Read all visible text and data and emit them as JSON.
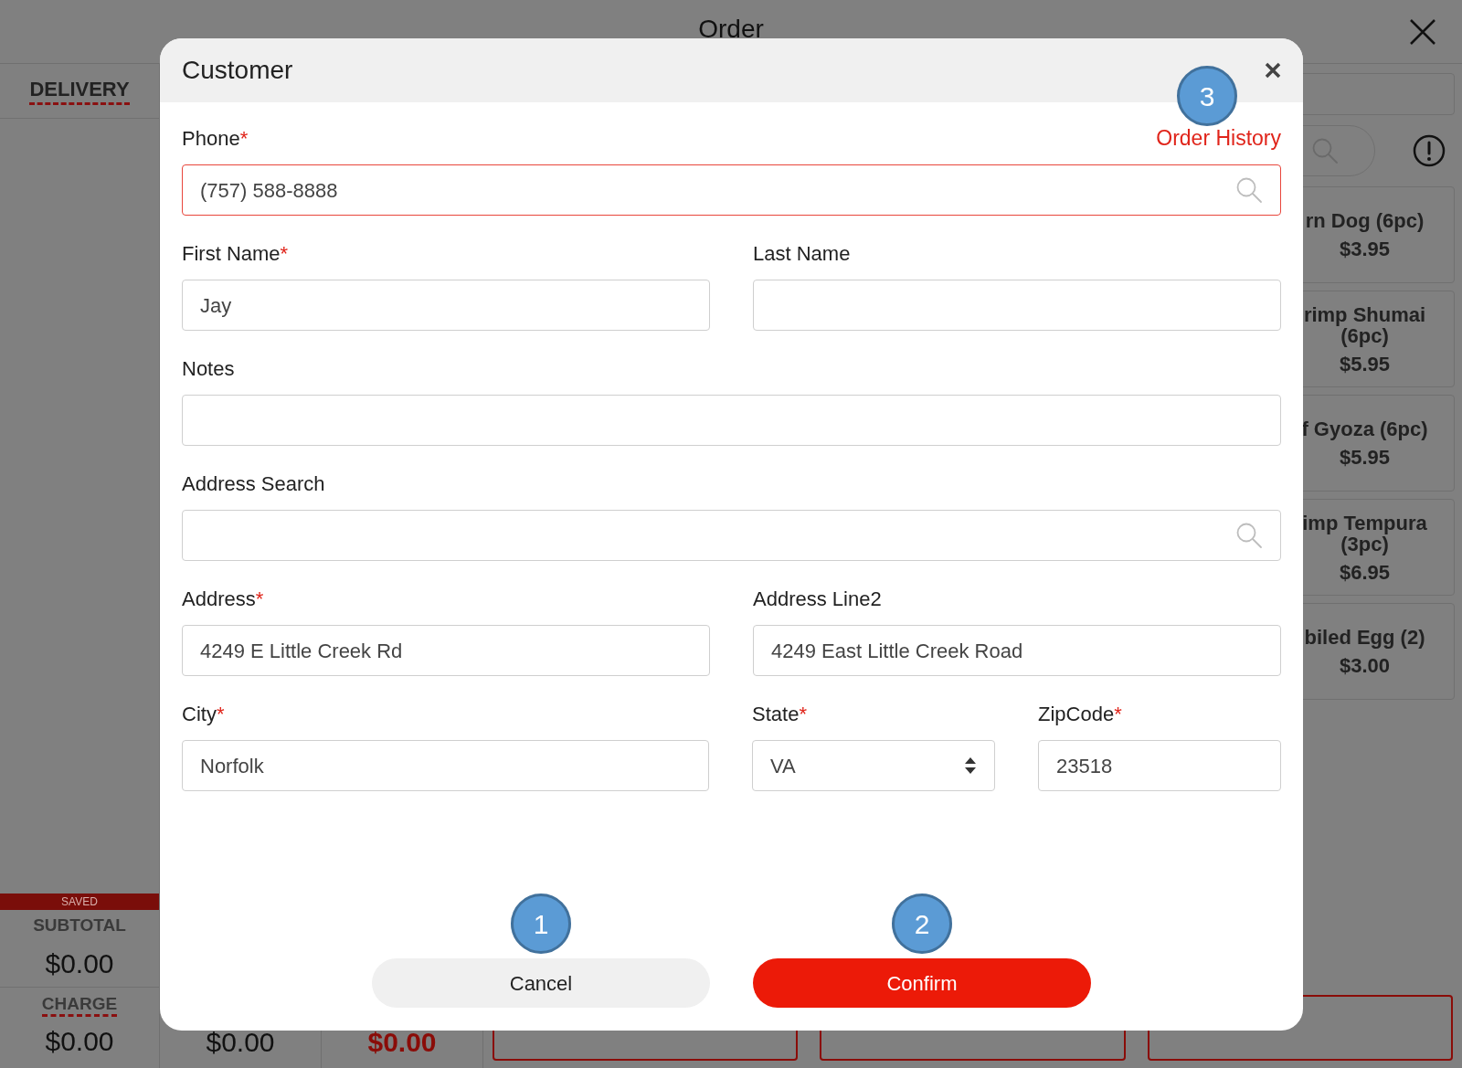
{
  "background": {
    "title": "Order",
    "tab": "DELIVERY",
    "saved": "SAVED",
    "subtotal_label": "SUBTOTAL",
    "subtotal": "$0.00",
    "charge_label": "CHARGE",
    "charge": "$0.00",
    "totals": [
      {
        "text": "$0.00",
        "emphasis": false
      },
      {
        "text": "$0.00",
        "emphasis": true
      }
    ],
    "menu_items": [
      {
        "name": "rn Dog (6pc)",
        "price": "$3.95"
      },
      {
        "name": "rimp Shumai (6pc)",
        "price": "$5.95"
      },
      {
        "name": "f Gyoza (6pc)",
        "price": "$5.95"
      },
      {
        "name": "imp Tempura (3pc)",
        "price": "$6.95"
      },
      {
        "name": "biled Egg (2)",
        "price": "$3.00"
      }
    ]
  },
  "dialog": {
    "title": "Customer",
    "order_history": {
      "label": "Order History",
      "marker": "3"
    },
    "rows": [
      [
        {
          "label": "Phone",
          "required_mark": "*",
          "value": "(757) 588-8888",
          "kind": "search",
          "highlighted": true
        }
      ],
      [
        {
          "label": "First Name",
          "required_mark": "*",
          "value": "Jay",
          "kind": "text",
          "highlighted": false
        },
        {
          "label": "Last Name",
          "kind": "text",
          "highlighted": false
        }
      ],
      [
        {
          "label": "Notes",
          "kind": "text",
          "highlighted": false
        }
      ],
      [
        {
          "label": "Address Search",
          "kind": "search",
          "highlighted": false
        }
      ],
      [
        {
          "label": "Address",
          "required_mark": "*",
          "value": "4249 E Little Creek Rd",
          "kind": "text",
          "highlighted": false
        },
        {
          "label": "Address Line2",
          "value": "4249 East Little Creek Road",
          "kind": "text",
          "highlighted": false
        }
      ],
      [
        {
          "label": "City",
          "required_mark": "*",
          "value": "Norfolk",
          "kind": "text",
          "highlighted": false
        },
        {
          "label": "State",
          "required_mark": "*",
          "value": "VA",
          "kind": "select",
          "highlighted": false
        },
        {
          "label": "ZipCode",
          "required_mark": "*",
          "value": "23518",
          "kind": "text",
          "highlighted": false
        }
      ]
    ],
    "buttons": [
      {
        "label": "Cancel",
        "kind": "secondary",
        "marker": "1"
      },
      {
        "label": "Confirm",
        "kind": "primary",
        "marker": "2"
      }
    ]
  }
}
